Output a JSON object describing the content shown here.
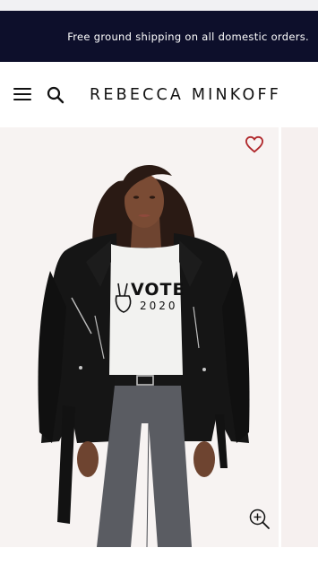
{
  "promo": {
    "text": "Free ground shipping on all domestic orders."
  },
  "header": {
    "brand": "REBECCA MINKOFF",
    "menu_icon": "hamburger-menu-icon",
    "search_icon": "search-icon"
  },
  "product_image": {
    "shirt_text_line1": "VOTE",
    "shirt_text_line2": "2020",
    "wishlist_icon": "heart-icon",
    "zoom_icon": "zoom-in-icon"
  },
  "colors": {
    "promo_background": "#0d0f2b",
    "promo_text": "#ffffff",
    "wishlist_heart": "#b0282c",
    "brand_text": "#111111"
  }
}
